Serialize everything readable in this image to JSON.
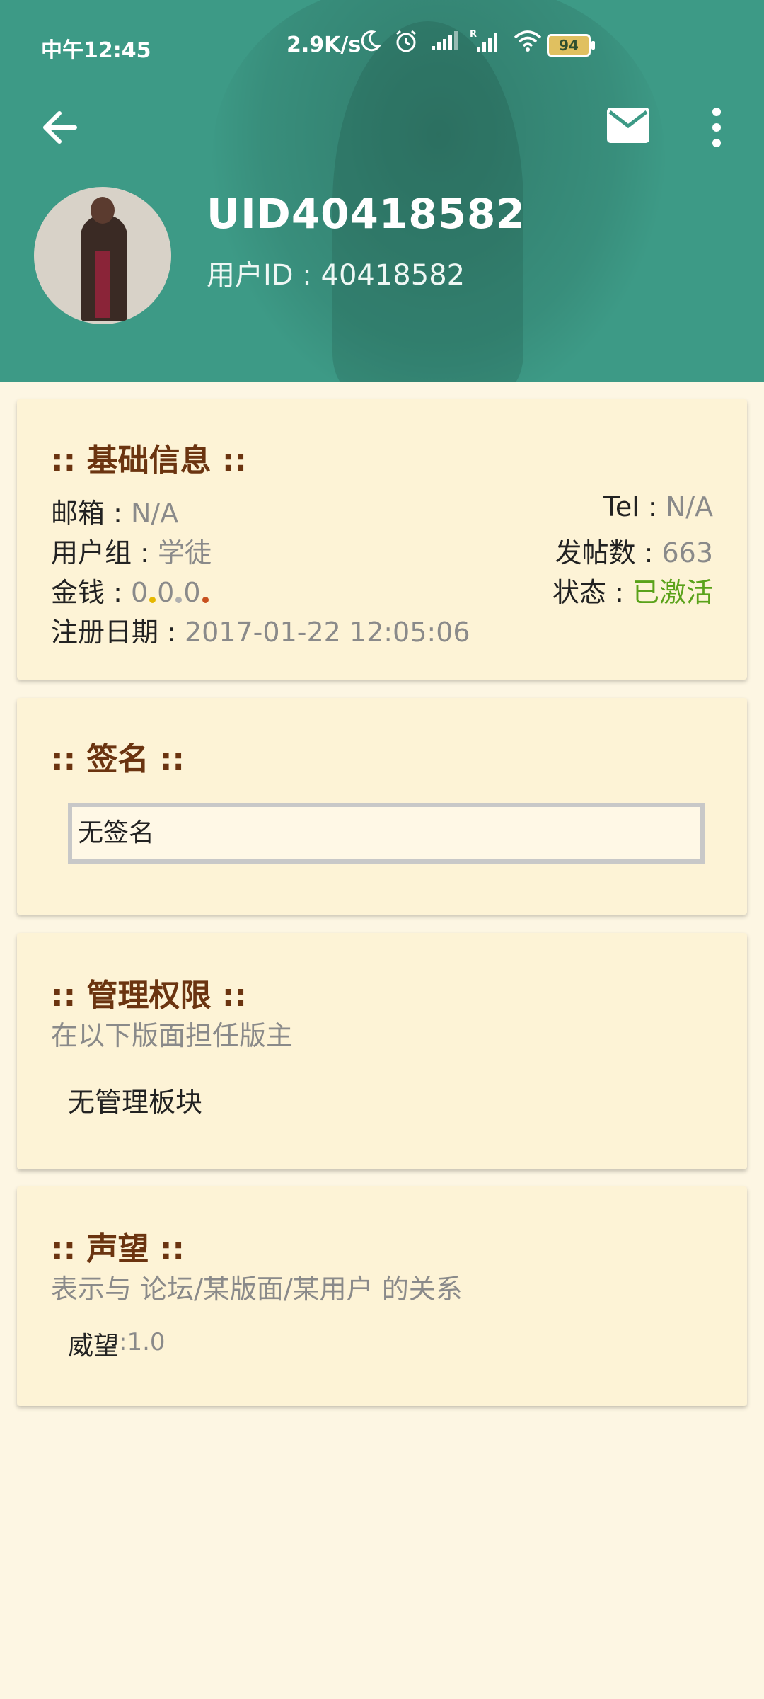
{
  "status_bar": {
    "time": "中午12:45",
    "speed": "2.9K/s",
    "battery": "94",
    "icons": [
      "moon-icon",
      "alarm-icon",
      "signal-icon",
      "signal-r-icon",
      "wifi-icon",
      "battery-icon"
    ]
  },
  "header": {
    "title": "UID40418582",
    "subtitle": "用户ID : 40418582",
    "back_icon": "arrow-left-icon",
    "mail_icon": "mail-icon",
    "more_icon": "more-vert-icon",
    "accent": "#3d9a86"
  },
  "basic_info": {
    "title": ":: 基础信息 ::",
    "email_label": "邮箱 : ",
    "email_value": " N/A",
    "tel_label": "Tel : ",
    "tel_value": "N/A",
    "group_label": "用户组 : ",
    "group_value": "学徒",
    "posts_label": "发帖数 : ",
    "posts_value": "663",
    "money_label": "金钱 : ",
    "money_value_1": "0",
    "money_value_2": "0",
    "money_value_3": "0",
    "status_label": "状态 : ",
    "status_value": "已激活",
    "reg_label": "注册日期 : ",
    "reg_value": "2017-01-22 12:05:06",
    "status_color": "#5aa21a"
  },
  "signature": {
    "title": ":: 签名 ::",
    "text": "无签名"
  },
  "admin": {
    "title": ":: 管理权限 ::",
    "desc": "在以下版面担任版主",
    "value": "无管理板块"
  },
  "reputation": {
    "title": ":: 声望 ::",
    "desc": "表示与 论坛/某版面/某用户 的关系",
    "label": "威望",
    "value": ":1.0"
  }
}
